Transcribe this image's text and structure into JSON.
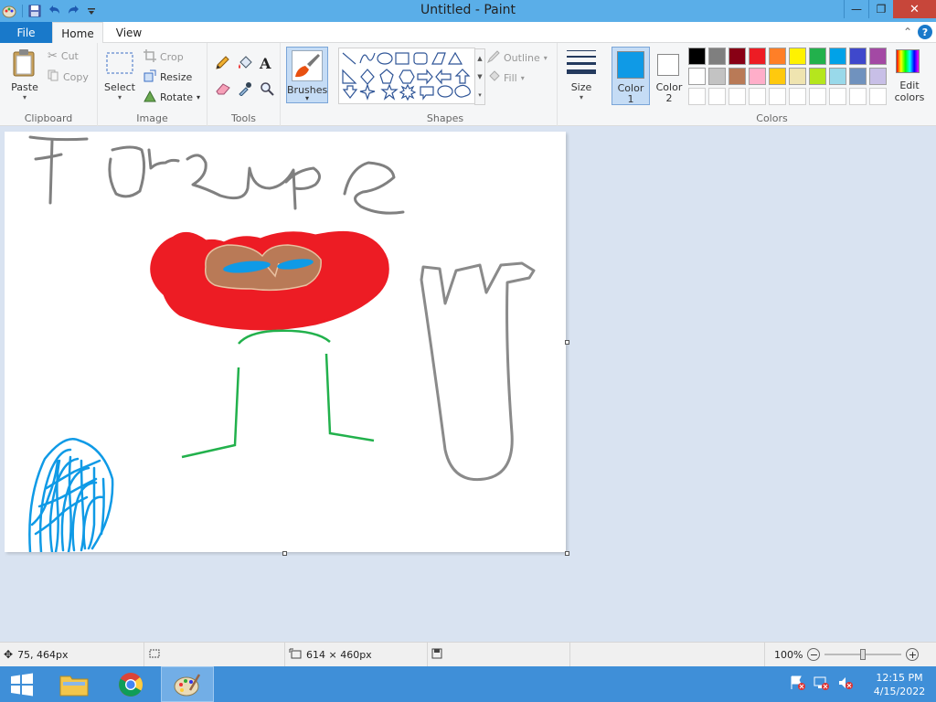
{
  "window": {
    "title": "Untitled - Paint"
  },
  "tabs": {
    "file": "File",
    "home": "Home",
    "view": "View"
  },
  "clipboard": {
    "paste": "Paste",
    "cut": "Cut",
    "copy": "Copy",
    "label": "Clipboard"
  },
  "image": {
    "select": "Select",
    "crop": "Crop",
    "resize": "Resize",
    "rotate": "Rotate",
    "label": "Image"
  },
  "tools": {
    "label": "Tools"
  },
  "brushes": {
    "label": "Brushes"
  },
  "shapes": {
    "outline": "Outline",
    "fill": "Fill",
    "label": "Shapes"
  },
  "size": {
    "label": "Size"
  },
  "colors": {
    "color1": "Color",
    "color1_num": "1",
    "color2": "Color",
    "color2_num": "2",
    "edit_colors_line1": "Edit",
    "edit_colors_line2": "colors",
    "label": "Colors",
    "color1_value": "#0f9ae6",
    "color2_value": "#ffffff",
    "palette_row1": [
      "#000000",
      "#7f7f7f",
      "#880015",
      "#ed1c24",
      "#ff7f27",
      "#fff200",
      "#22b14c",
      "#00a2e8",
      "#3f48cc",
      "#a349a4"
    ],
    "palette_row2": [
      "#ffffff",
      "#c3c3c3",
      "#b97a57",
      "#ffaec9",
      "#ffc90e",
      "#efe4b0",
      "#b5e61d",
      "#99d9ea",
      "#7092be",
      "#c8bfe7"
    ]
  },
  "status": {
    "cursor_pos": "75, 464px",
    "canvas_size": "614 × 460px",
    "zoom": "100%"
  },
  "taskbar": {
    "time": "12:15 PM",
    "date": "4/15/2022"
  }
}
